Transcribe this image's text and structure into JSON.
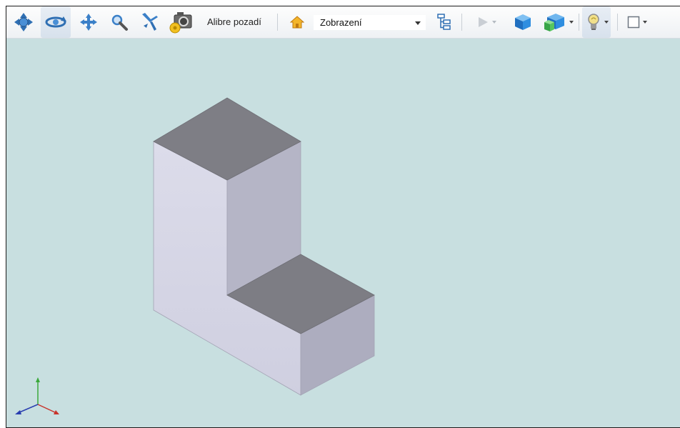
{
  "toolbar": {
    "background_label": "Alibre pozadí",
    "view_select": {
      "value": "Zobrazení"
    },
    "icons": [
      "orbit-icon",
      "rotate-icon",
      "pan-icon",
      "zoom-icon",
      "fly-icon",
      "camera-icon",
      "home-icon",
      "tree-icon",
      "play-icon",
      "shaded-cube-icon",
      "display-style-icon",
      "lighting-icon",
      "frame-icon"
    ]
  },
  "viewport": {
    "background": "#c8dfe0",
    "model": {
      "front_face_color": "#d6d6e6",
      "side_face_color": "#b0b0c1",
      "top_face_color": "#7d7d84"
    },
    "axis_triad": {
      "x_color": "#c8342b",
      "y_color": "#3aa83a",
      "z_color": "#2a3fb0"
    }
  }
}
